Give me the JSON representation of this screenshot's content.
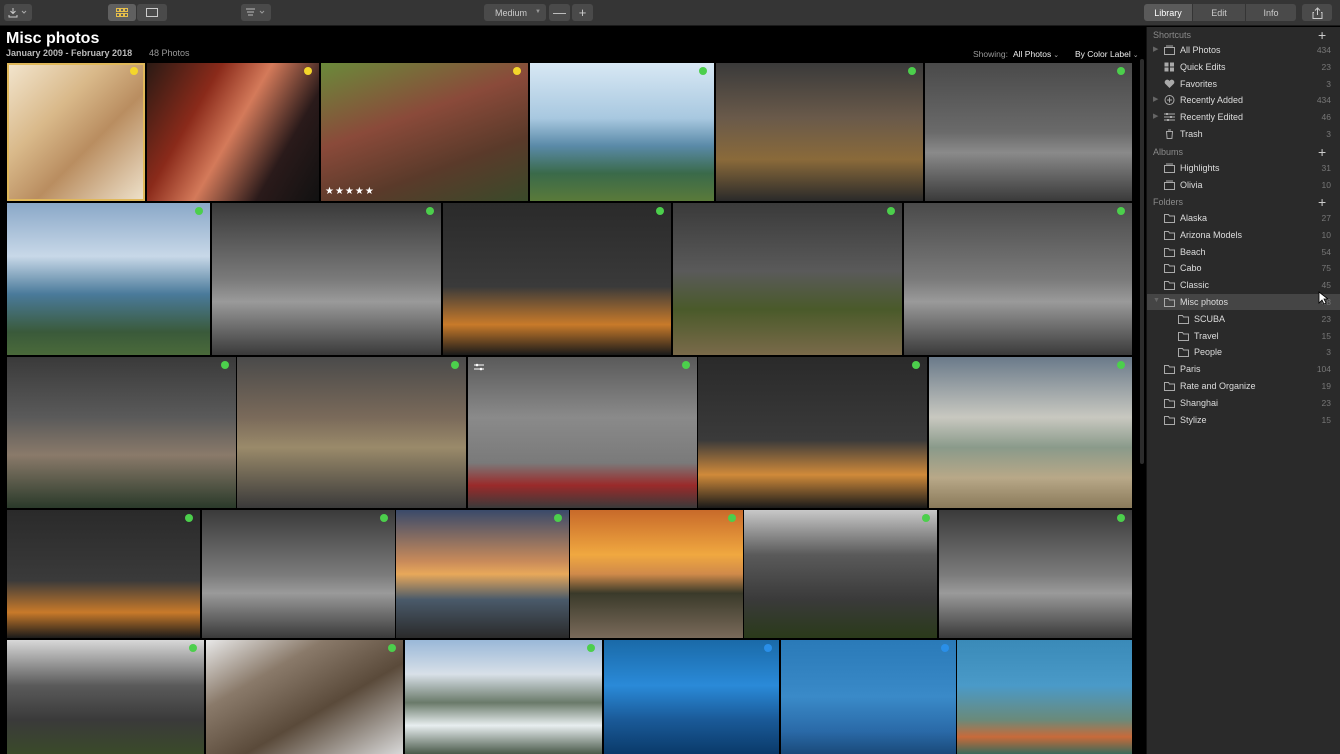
{
  "toolbar": {
    "size_label": "Medium",
    "zoom_out": "—",
    "zoom_in": "+",
    "tabs": [
      {
        "label": "Library",
        "active": true
      },
      {
        "label": "Edit",
        "active": false
      },
      {
        "label": "Info",
        "active": false
      }
    ],
    "icons": {
      "import": "import-icon",
      "grid": "grid-view-icon",
      "single": "single-view-icon",
      "sort": "sort-icon",
      "share": "share-icon"
    }
  },
  "header": {
    "title": "Misc photos",
    "date_range": "January 2009 - February 2018",
    "count": "48 Photos",
    "showing_label": "Showing:",
    "showing_value": "All Photos",
    "color_label": "By Color Label"
  },
  "colors": {
    "green": "#4ccf4c",
    "yellow": "#f4d62b",
    "blue": "#2a8fe8",
    "selection": "#e0b85a"
  },
  "photos": [
    {
      "id": "portrait-blonde",
      "label": "yellow",
      "selected": true,
      "rating": "",
      "bg": "linear-gradient(135deg,#f3e6cf 0%,#d9b98a 35%,#b98d60 60%,#efe3cd 100%)"
    },
    {
      "id": "portrait-butterflies",
      "label": "yellow",
      "selected": false,
      "rating": "",
      "bg": "linear-gradient(120deg,#2a1a14 0%,#8a2a1a 30%,#d47a5a 50%,#2a1a1a 75%,#111 100%)"
    },
    {
      "id": "kids-bench",
      "label": "yellow",
      "selected": false,
      "rating": "★★★★★",
      "bg": "linear-gradient(160deg,#6a8a3a 0%,#8a4a3a 40%,#5a3a2a 70%,#3a4a2a 100%)"
    },
    {
      "id": "coast-bay-1",
      "label": "green",
      "selected": false,
      "rating": "",
      "bg": "linear-gradient(180deg,#d8e8f4 0%,#a8c8e0 40%,#5a8aa8 60%,#3a6a4a 80%,#5a7a3a 100%)"
    },
    {
      "id": "city-night-1",
      "label": "green",
      "selected": false,
      "rating": "",
      "bg": "linear-gradient(180deg,#3a3a3a 0%,#6a5a4a 40%,#8a6a3a 70%,#2a2a2a 100%)"
    },
    {
      "id": "capitol-1",
      "label": "green",
      "selected": false,
      "rating": "",
      "bg": "linear-gradient(180deg,#4a4a4a 0%,#6a6a6a 50%,#8a8a8a 65%,#3a3a3a 100%)"
    },
    {
      "id": "coast-bay-2",
      "label": "green",
      "selected": false,
      "rating": "",
      "bg": "linear-gradient(180deg,#8aa8c8 0%,#c8d8e8 35%,#4a7a9a 60%,#3a5a3a 85%,#4a6a3a 100%)"
    },
    {
      "id": "capitol-2",
      "label": "green",
      "selected": false,
      "rating": "",
      "bg": "linear-gradient(180deg,#3a3a3a 0%,#7a7a7a 50%,#9a9a9a 65%,#3a3a3a 100%)"
    },
    {
      "id": "monument-sunset-1",
      "label": "green",
      "selected": false,
      "rating": "",
      "bg": "linear-gradient(180deg,#2a2a2a 0%,#3a3a3a 55%,#c87a2a 80%,#1a1a1a 100%)"
    },
    {
      "id": "capitol-path",
      "label": "green",
      "selected": false,
      "rating": "",
      "bg": "linear-gradient(180deg,#3a3a3a 0%,#5a5a5a 45%,#4a5a2a 70%,#7a6a4a 100%)"
    },
    {
      "id": "capitol-3",
      "label": "green",
      "selected": false,
      "rating": "",
      "bg": "linear-gradient(180deg,#4a4a4a 0%,#7a7a7a 50%,#9a9a9a 65%,#3a3a3a 100%)"
    },
    {
      "id": "capitol-dusk",
      "label": "green",
      "selected": false,
      "rating": "",
      "bg": "linear-gradient(180deg,#3a3a3a 0%,#5a5a5a 40%,#8a7a6a 65%,#2a3a2a 100%)"
    },
    {
      "id": "city-night-2",
      "label": "green",
      "selected": false,
      "rating": "",
      "bg": "linear-gradient(180deg,#4a4a4a 0%,#7a6a5a 40%,#9a8a6a 60%,#3a3a3a 100%)"
    },
    {
      "id": "marina-boats",
      "label": "green",
      "selected": false,
      "rating": "",
      "bg": "linear-gradient(180deg,#5a5a5a 0%,#8a8a8a 40%,#7a7a7a 70%,#9a2a2a 85%,#3a3a3a 100%)"
    },
    {
      "id": "monument-sunset-2",
      "label": "green",
      "selected": false,
      "rating": "",
      "bg": "linear-gradient(180deg,#2a2a2a 0%,#3a3a3a 55%,#d08a3a 78%,#1a1a1a 100%)"
    },
    {
      "id": "beach-walker",
      "label": "green",
      "selected": false,
      "rating": "",
      "bg": "linear-gradient(180deg,#6a7a8a 0%,#c8c8c0 40%,#8a9a8a 60%,#b8a888 80%,#8a7a5a 100%)"
    },
    {
      "id": "monument-sunset-3",
      "label": "green",
      "selected": false,
      "rating": "",
      "bg": "linear-gradient(180deg,#2a2a2a 0%,#3a3a3a 55%,#c87a2a 80%,#1a1a1a 100%)"
    },
    {
      "id": "capitol-4",
      "label": "green",
      "selected": false,
      "rating": "",
      "bg": "linear-gradient(180deg,#3a3a3a 0%,#7a7a7a 50%,#9a9a9a 65%,#3a3a3a 100%)"
    },
    {
      "id": "sunset-beach-1",
      "label": "green",
      "selected": false,
      "rating": "",
      "bg": "linear-gradient(180deg,#3a4a6a 0%,#c88a5a 40%,#e8a85a 50%,#4a5a6a 70%,#2a2a2a 100%)"
    },
    {
      "id": "sunset-beach-2",
      "label": "green",
      "selected": false,
      "rating": "",
      "bg": "linear-gradient(180deg,#c86a2a 0%,#f0a840 35%,#d08a4a 50%,#3a3a2a 65%,#7a6a5a 100%)"
    },
    {
      "id": "cross-tree-1",
      "label": "green",
      "selected": false,
      "rating": "",
      "bg": "linear-gradient(180deg,#c8c8c8 0%,#5a5a5a 35%,#3a3a3a 70%,#2a3a1a 100%)"
    },
    {
      "id": "capitol-5",
      "label": "green",
      "selected": false,
      "rating": "",
      "bg": "linear-gradient(180deg,#3a3a3a 0%,#7a7a7a 50%,#9a9a9a 65%,#3a3a3a 100%)"
    },
    {
      "id": "cross-tree-2",
      "label": "green",
      "selected": false,
      "rating": "",
      "bg": "linear-gradient(180deg,#d8d8d8 0%,#5a5a5a 40%,#3a3a3a 70%,#3a4a2a 100%)"
    },
    {
      "id": "statue-bronze",
      "label": "green",
      "selected": false,
      "rating": "",
      "bg": "linear-gradient(150deg,#e8e8e8 0%,#8a7a6a 30%,#5a4a3a 60%,#d8d8d8 100%)"
    },
    {
      "id": "waterfall",
      "label": "green",
      "selected": false,
      "rating": "",
      "bg": "linear-gradient(180deg,#9ab8d8 0%,#d8e0e8 30%,#6a7a6a 55%,#e8eef0 75%,#4a5a4a 100%)"
    },
    {
      "id": "scuba-diver-1",
      "label": "blue",
      "selected": false,
      "rating": "",
      "bg": "linear-gradient(180deg,#1a6aa8 0%,#2a8ad8 40%,#1a5a98 70%,#0a3a6a 100%)"
    },
    {
      "id": "scuba-diver-2",
      "label": "blue",
      "selected": false,
      "rating": "",
      "bg": "linear-gradient(180deg,#2a7ab8 0%,#3a8ac8 50%,#2a6aa8 80%,#1a4a7a 100%)"
    },
    {
      "id": "coral-reef",
      "label": "",
      "selected": false,
      "rating": "",
      "bg": "linear-gradient(180deg,#3a8ab8 0%,#4a9ac8 40%,#6a8a7a 70%,#c86a3a 85%,#3a6a5a 100%)"
    }
  ],
  "sidebar": {
    "shortcuts_title": "Shortcuts",
    "shortcuts": [
      {
        "label": "All Photos",
        "count": "434",
        "icon": "photos-stack-icon"
      },
      {
        "label": "Quick Edits",
        "count": "23",
        "icon": "quick-edits-icon"
      },
      {
        "label": "Favorites",
        "count": "3",
        "icon": "heart-icon"
      },
      {
        "label": "Recently Added",
        "count": "434",
        "icon": "plus-circle-icon"
      },
      {
        "label": "Recently Edited",
        "count": "46",
        "icon": "sliders-icon"
      },
      {
        "label": "Trash",
        "count": "3",
        "icon": "trash-icon"
      }
    ],
    "albums_title": "Albums",
    "albums": [
      {
        "label": "Highlights",
        "count": "31"
      },
      {
        "label": "Olivia",
        "count": "10"
      }
    ],
    "folders_title": "Folders",
    "folders": [
      {
        "label": "Alaska",
        "count": "27",
        "level": 0
      },
      {
        "label": "Arizona Models",
        "count": "10",
        "level": 0
      },
      {
        "label": "Beach",
        "count": "54",
        "level": 0
      },
      {
        "label": "Cabo",
        "count": "75",
        "level": 0
      },
      {
        "label": "Classic",
        "count": "45",
        "level": 0
      },
      {
        "label": "Misc photos",
        "count": "48",
        "level": 0,
        "active": true
      },
      {
        "label": "SCUBA",
        "count": "23",
        "level": 1
      },
      {
        "label": "Travel",
        "count": "15",
        "level": 1
      },
      {
        "label": "People",
        "count": "3",
        "level": 1
      },
      {
        "label": "Paris",
        "count": "104",
        "level": 0
      },
      {
        "label": "Rate and Organize",
        "count": "19",
        "level": 0
      },
      {
        "label": "Shanghai",
        "count": "23",
        "level": 0
      },
      {
        "label": "Stylize",
        "count": "15",
        "level": 0
      }
    ]
  }
}
